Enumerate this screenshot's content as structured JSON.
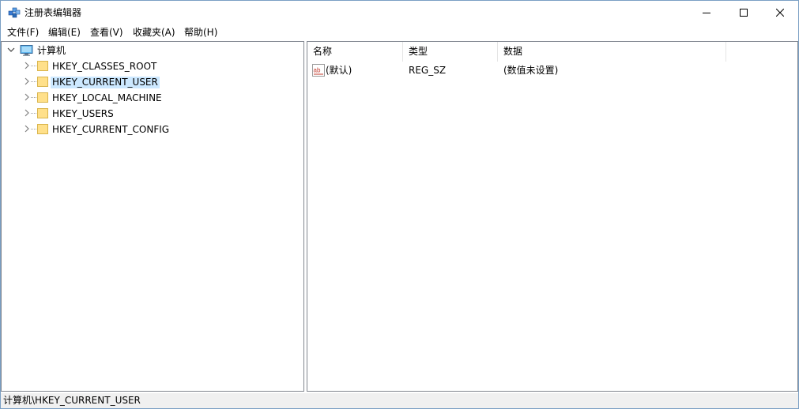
{
  "window": {
    "title": "注册表编辑器"
  },
  "menu": [
    {
      "label": "文件(F)"
    },
    {
      "label": "编辑(E)"
    },
    {
      "label": "查看(V)"
    },
    {
      "label": "收藏夹(A)"
    },
    {
      "label": "帮助(H)"
    }
  ],
  "tree": {
    "root": {
      "label": "计算机",
      "icon": "computer-icon",
      "expanded": true
    },
    "hives": [
      {
        "label": "HKEY_CLASSES_ROOT",
        "selected": false
      },
      {
        "label": "HKEY_CURRENT_USER",
        "selected": true
      },
      {
        "label": "HKEY_LOCAL_MACHINE",
        "selected": false
      },
      {
        "label": "HKEY_USERS",
        "selected": false
      },
      {
        "label": "HKEY_CURRENT_CONFIG",
        "selected": false
      }
    ]
  },
  "list": {
    "columns": [
      {
        "label": "名称"
      },
      {
        "label": "类型"
      },
      {
        "label": "数据"
      }
    ],
    "rows": [
      {
        "name": "(默认)",
        "type": "REG_SZ",
        "data": "(数值未设置)",
        "icon": "string-value-icon"
      }
    ]
  },
  "status": {
    "path": "计算机\\HKEY_CURRENT_USER"
  },
  "colors": {
    "selection": "#cce8ff",
    "border": "#828790",
    "statusbar": "#f0f0f0"
  }
}
